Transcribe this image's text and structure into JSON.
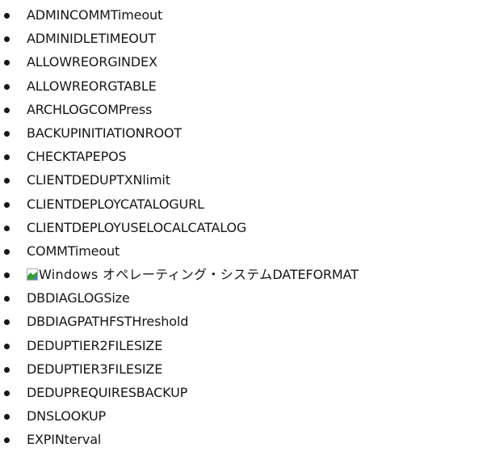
{
  "options": [
    {
      "label": "ADMINCOMMTimeout"
    },
    {
      "label": "ADMINIDLETIMEOUT"
    },
    {
      "label": "ALLOWREORGINDEX"
    },
    {
      "label": "ALLOWREORGTABLE"
    },
    {
      "label": "ARCHLOGCOMPress"
    },
    {
      "label": "BACKUPINITIATIONROOT"
    },
    {
      "label": "CHECKTAPEPOS"
    },
    {
      "label": "CLIENTDEDUPTXNlimit"
    },
    {
      "label": "CLIENTDEPLOYCATALOGURL"
    },
    {
      "label": "CLIENTDEPLOYUSELOCALCATALOG"
    },
    {
      "label": "COMMTimeout"
    },
    {
      "label": "DATEFORMAT",
      "prefix": "Windows オペレーティング・システム",
      "icon": "broken-image-icon"
    },
    {
      "label": "DBDIAGLOGSize"
    },
    {
      "label": "DBDIAGPATHFSTHreshold"
    },
    {
      "label": "DEDUPTIER2FILESIZE"
    },
    {
      "label": "DEDUPTIER3FILESIZE"
    },
    {
      "label": "DEDUPREQUIRESBACKUP"
    },
    {
      "label": "DNSLOOKUP"
    },
    {
      "label": "EXPINterval"
    }
  ]
}
